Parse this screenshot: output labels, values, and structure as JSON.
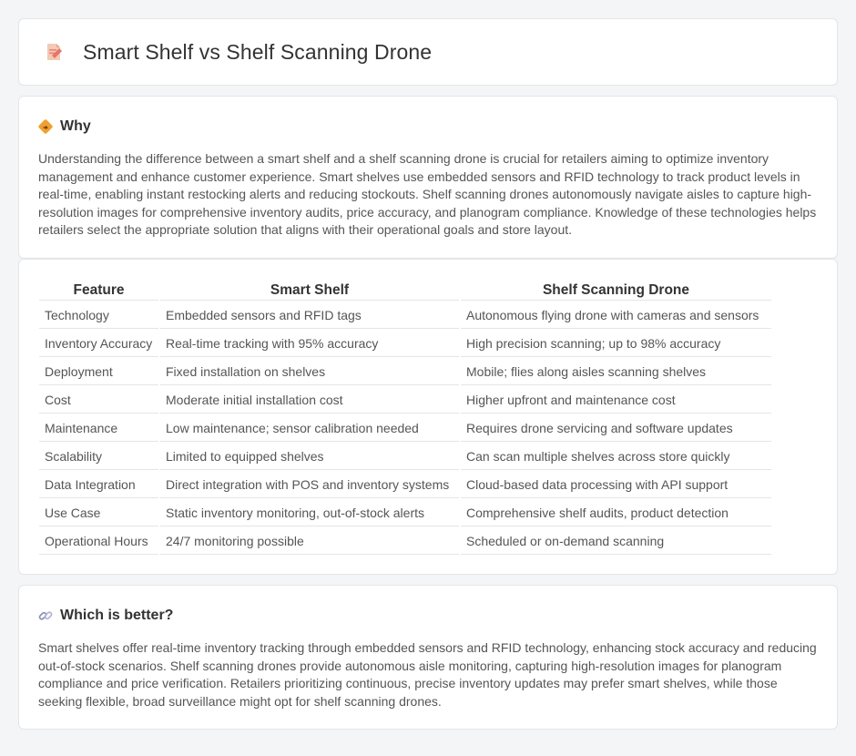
{
  "header": {
    "title": "Smart Shelf vs Shelf Scanning Drone",
    "icon": "document-pencil-icon"
  },
  "why": {
    "icon": "diamond-sign-icon",
    "title": "Why",
    "text": "Understanding the difference between a smart shelf and a shelf scanning drone is crucial for retailers aiming to optimize inventory management and enhance customer experience. Smart shelves use embedded sensors and RFID technology to track product levels in real-time, enabling instant restocking alerts and reducing stockouts. Shelf scanning drones autonomously navigate aisles to capture high-resolution images for comprehensive inventory audits, price accuracy, and planogram compliance. Knowledge of these technologies helps retailers select the appropriate solution that aligns with their operational goals and store layout."
  },
  "comparison": {
    "headers": [
      "Feature",
      "Smart Shelf",
      "Shelf Scanning Drone"
    ],
    "rows": [
      [
        "Technology",
        "Embedded sensors and RFID tags",
        "Autonomous flying drone with cameras and sensors"
      ],
      [
        "Inventory Accuracy",
        "Real-time tracking with 95% accuracy",
        "High precision scanning; up to 98% accuracy"
      ],
      [
        "Deployment",
        "Fixed installation on shelves",
        "Mobile; flies along aisles scanning shelves"
      ],
      [
        "Cost",
        "Moderate initial installation cost",
        "Higher upfront and maintenance cost"
      ],
      [
        "Maintenance",
        "Low maintenance; sensor calibration needed",
        "Requires drone servicing and software updates"
      ],
      [
        "Scalability",
        "Limited to equipped shelves",
        "Can scan multiple shelves across store quickly"
      ],
      [
        "Data Integration",
        "Direct integration with POS and inventory systems",
        "Cloud-based data processing with API support"
      ],
      [
        "Use Case",
        "Static inventory monitoring, out-of-stock alerts",
        "Comprehensive shelf audits, product detection"
      ],
      [
        "Operational Hours",
        "24/7 monitoring possible",
        "Scheduled or on-demand scanning"
      ]
    ]
  },
  "better": {
    "icon": "link-icon",
    "title": "Which is better?",
    "text": "Smart shelves offer real-time inventory tracking through embedded sensors and RFID technology, enhancing stock accuracy and reducing out-of-stock scenarios. Shelf scanning drones provide autonomous aisle monitoring, capturing high-resolution images for planogram compliance and price verification. Retailers prioritizing continuous, precise inventory updates may prefer smart shelves, while those seeking flexible, broad surveillance might opt for shelf scanning drones."
  },
  "colors": {
    "background": "#f4f5f7",
    "card": "#ffffff",
    "border": "#e3e5e8",
    "accent_orange": "#f0a030",
    "icon_pink": "#e8736a"
  }
}
